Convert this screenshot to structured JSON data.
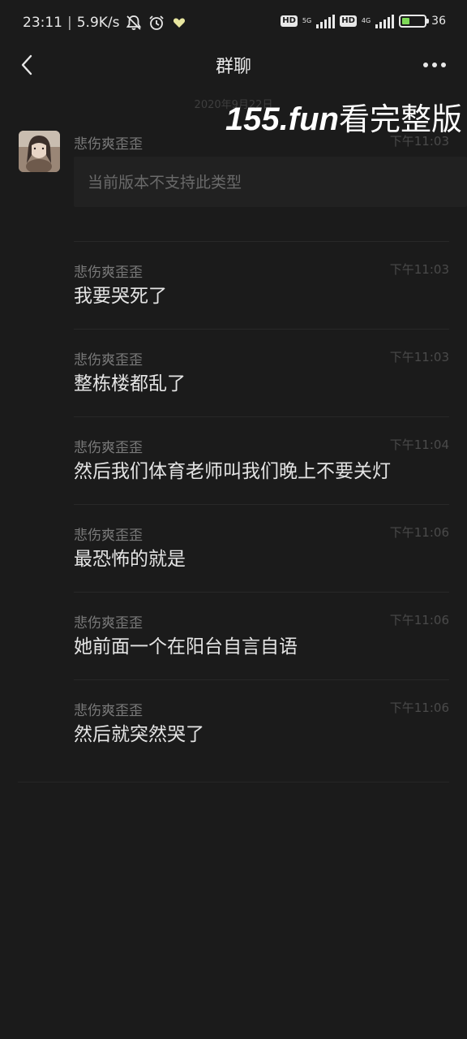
{
  "status_bar": {
    "time": "23:11",
    "separator": "|",
    "net_speed": "5.9K/s",
    "battery_text": "36",
    "battery_level": 0.36,
    "hd1": "HD",
    "hd2": "HD",
    "net1": "5G",
    "net2": "4G",
    "icons": [
      "bell-off-icon",
      "alarm-icon",
      "heart-icon",
      "signal-icon",
      "battery-icon"
    ]
  },
  "nav": {
    "title": "群聊",
    "back_icon": "chevron-left-icon",
    "more_icon": "more-dots-icon"
  },
  "date_label": "2020年9月22日",
  "watermark": {
    "url": "155.fun",
    "text": "看完整版"
  },
  "messages": [
    {
      "sender": "悲伤爽歪歪",
      "time": "下午11:03",
      "text": "",
      "unsupported": "当前版本不支持此类型"
    },
    {
      "sender": "悲伤爽歪歪",
      "time": "下午11:03",
      "text": "我要哭死了"
    },
    {
      "sender": "悲伤爽歪歪",
      "time": "下午11:03",
      "text": "整栋楼都乱了"
    },
    {
      "sender": "悲伤爽歪歪",
      "time": "下午11:04",
      "text": "然后我们体育老师叫我们晚上不要关灯"
    },
    {
      "sender": "悲伤爽歪歪",
      "time": "下午11:06",
      "text": "最恐怖的就是"
    },
    {
      "sender": "悲伤爽歪歪",
      "time": "下午11:06",
      "text": "她前面一个在阳台自言自语"
    },
    {
      "sender": "悲伤爽歪歪",
      "time": "下午11:06",
      "text": "然后就突然哭了"
    }
  ],
  "colors": {
    "background": "#1b1b1b",
    "text": "#e4e4e4",
    "muted": "#7a7a7a",
    "battery_fill": "#7ed957"
  }
}
